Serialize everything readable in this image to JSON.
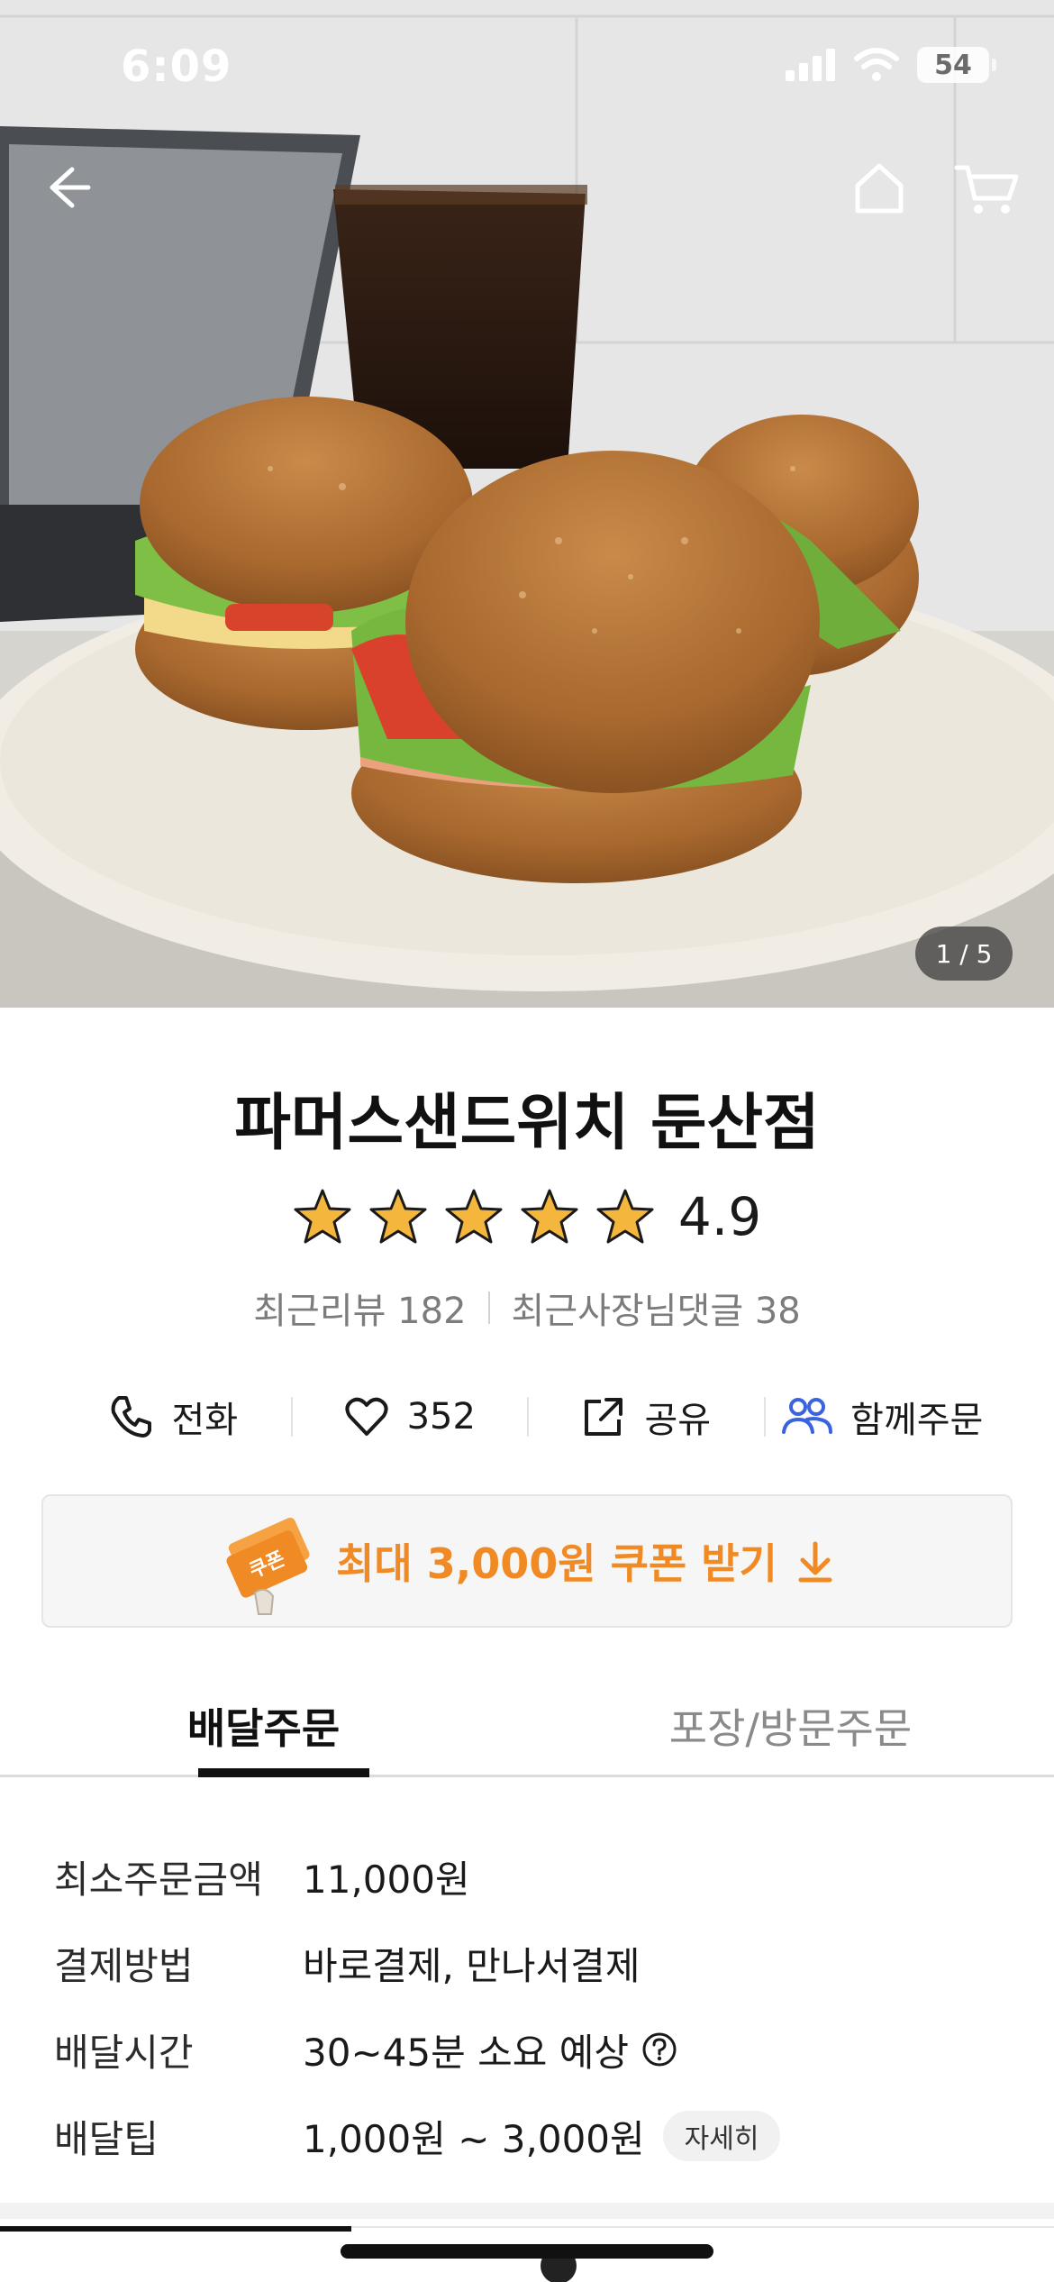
{
  "status_bar": {
    "time": "6:09",
    "battery": "54"
  },
  "hero": {
    "image_counter": "1 / 5"
  },
  "store": {
    "name": "파머스샌드위치 둔산점",
    "rating": "4.9",
    "stars": 5,
    "recent_reviews": "최근리뷰 182",
    "owner_comments": "최근사장님댓글 38"
  },
  "actions": {
    "call": "전화",
    "likes": "352",
    "share": "공유",
    "group_order": "함께주문"
  },
  "coupon": {
    "icon_label": "쿠폰",
    "text": "최대 3,000원 쿠폰 받기"
  },
  "tabs": {
    "delivery": "배달주문",
    "pickup": "포장/방문주문"
  },
  "info": {
    "min_order_label": "최소주문금액",
    "min_order_value": "11,000원",
    "payment_label": "결제방법",
    "payment_value": "바로결제, 만나서결제",
    "time_label": "배달시간",
    "time_value": "30~45분 소요 예상",
    "tip_label": "배달팁",
    "tip_value": "1,000원 ~ 3,000원",
    "tip_detail": "자세히"
  },
  "colors": {
    "accent": "#f08a24",
    "star": "#f4b63c",
    "group_order_icon": "#3b63e0"
  }
}
